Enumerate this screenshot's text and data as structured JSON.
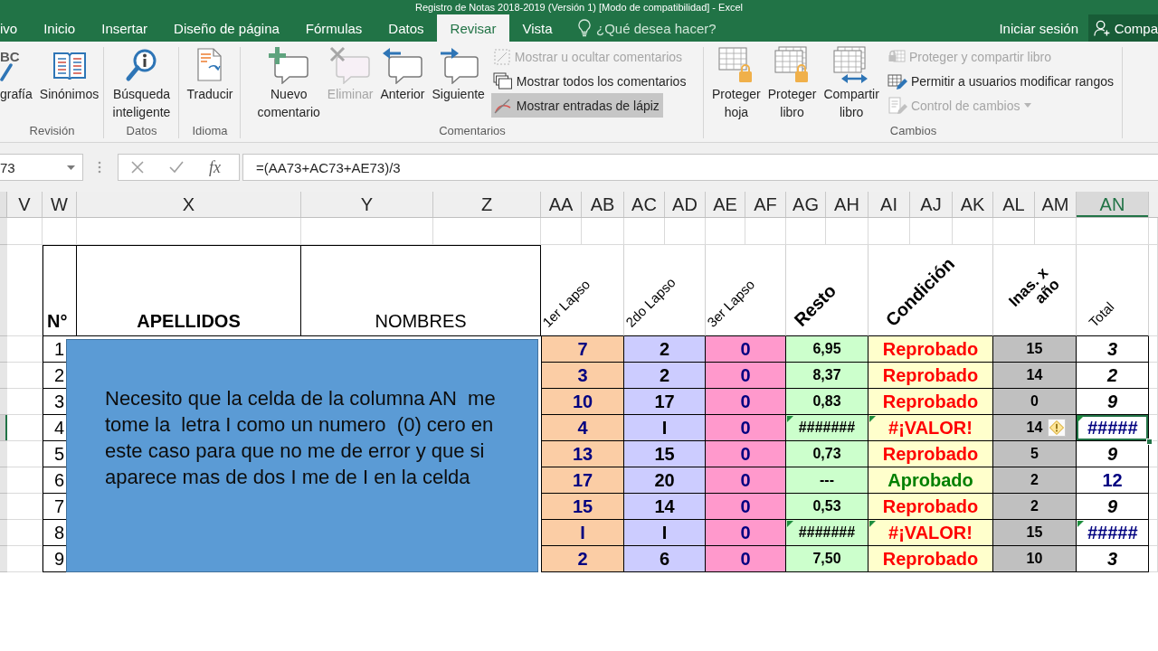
{
  "window": {
    "title": "Registro de Notas 2018-2019 (Versión 1) [Modo de compatibilidad] - Excel"
  },
  "ribbon_tabs": [
    {
      "label": "ivo",
      "selected": false
    },
    {
      "label": "Inicio",
      "selected": false
    },
    {
      "label": "Insertar",
      "selected": false
    },
    {
      "label": "Diseño de página",
      "selected": false
    },
    {
      "label": "Fórmulas",
      "selected": false
    },
    {
      "label": "Datos",
      "selected": false
    },
    {
      "label": "Revisar",
      "selected": true
    },
    {
      "label": "Vista",
      "selected": false
    }
  ],
  "tell_me": {
    "placeholder": "¿Qué desea hacer?"
  },
  "account": {
    "sign_in": "Iniciar sesión",
    "share": "Compa"
  },
  "ribbon_groups": [
    {
      "label": "Revisión",
      "buttons": [
        {
          "label": "grafía",
          "icon_text": "BC",
          "disabled": false
        },
        {
          "label": "Sinónimos",
          "disabled": false
        }
      ]
    },
    {
      "label": "Datos",
      "buttons": [
        {
          "label": "Búsqueda inteligente",
          "disabled": false
        }
      ]
    },
    {
      "label": "Idioma",
      "buttons": [
        {
          "label": "Traducir",
          "disabled": false
        }
      ]
    },
    {
      "label": "Comentarios",
      "buttons": [
        {
          "label": "Nuevo comentario",
          "disabled": false
        },
        {
          "label": "Eliminar",
          "disabled": true
        },
        {
          "label": "Anterior",
          "disabled": false
        },
        {
          "label": "Siguiente",
          "disabled": false
        }
      ],
      "small_buttons": [
        {
          "label": "Mostrar u ocultar comentarios",
          "disabled": true,
          "pressed": false,
          "dropdown": false
        },
        {
          "label": "Mostrar todos los comentarios",
          "disabled": false,
          "pressed": false,
          "dropdown": false
        },
        {
          "label": "Mostrar entradas de lápiz",
          "disabled": false,
          "pressed": true,
          "dropdown": false
        }
      ]
    },
    {
      "label": "Cambios",
      "buttons": [
        {
          "label": "Proteger hoja",
          "disabled": false
        },
        {
          "label": "Proteger libro",
          "disabled": false
        },
        {
          "label": "Compartir libro",
          "disabled": false
        }
      ],
      "small_buttons": [
        {
          "label": "Proteger y compartir libro",
          "disabled": true,
          "pressed": false,
          "dropdown": false
        },
        {
          "label": "Permitir a usuarios modificar rangos",
          "disabled": false,
          "pressed": false,
          "dropdown": false
        },
        {
          "label": "Control de cambios",
          "disabled": true,
          "pressed": false,
          "dropdown": true
        }
      ]
    }
  ],
  "formula_bar": {
    "name_box": "73",
    "function_label": "fx",
    "formula": "=(AA73+AC73+AE73)/3"
  },
  "columns": [
    {
      "label": "V",
      "selected": false
    },
    {
      "label": "W",
      "selected": false
    },
    {
      "label": "X",
      "selected": false
    },
    {
      "label": "Y",
      "selected": false
    },
    {
      "label": "Z",
      "selected": false
    },
    {
      "label": "AA",
      "selected": false
    },
    {
      "label": "AB",
      "selected": false
    },
    {
      "label": "AC",
      "selected": false
    },
    {
      "label": "AD",
      "selected": false
    },
    {
      "label": "AE",
      "selected": false
    },
    {
      "label": "AF",
      "selected": false
    },
    {
      "label": "AG",
      "selected": false
    },
    {
      "label": "AH",
      "selected": false
    },
    {
      "label": "AI",
      "selected": false
    },
    {
      "label": "AJ",
      "selected": false
    },
    {
      "label": "AK",
      "selected": false
    },
    {
      "label": "AL",
      "selected": false
    },
    {
      "label": "AM",
      "selected": false
    },
    {
      "label": "AN",
      "selected": true
    }
  ],
  "table": {
    "headers": {
      "number": "N°",
      "surnames": "APELLIDOS",
      "names": "NOMBRES",
      "lapso_1": "1er Lapso",
      "lapso_2": "2do Lapso",
      "lapso_3": "3er Lapso",
      "resto": "Resto",
      "condicion": "Condición",
      "inasistencias": "Inas. x año",
      "total": "Total"
    },
    "rows": [
      {
        "number": "1",
        "lapso_1": "7",
        "lapso_2": "2",
        "lapso_3": "0",
        "resto": {
          "text": "6,95",
          "error_indicator": false
        },
        "condicion": {
          "text": "Reprobado",
          "color": "#ff0000",
          "error_indicator": false
        },
        "inasistencias": "15",
        "total": {
          "text": "3",
          "color": "#000000",
          "italic": true,
          "error_indicator": false
        },
        "selected": false
      },
      {
        "number": "2",
        "lapso_1": "3",
        "lapso_2": "2",
        "lapso_3": "0",
        "resto": {
          "text": "8,37",
          "error_indicator": false
        },
        "condicion": {
          "text": "Reprobado",
          "color": "#ff0000",
          "error_indicator": false
        },
        "inasistencias": "14",
        "total": {
          "text": "2",
          "color": "#000000",
          "italic": true,
          "error_indicator": false
        },
        "selected": false
      },
      {
        "number": "3",
        "lapso_1": "10",
        "lapso_2": "17",
        "lapso_3": "0",
        "resto": {
          "text": "0,83",
          "error_indicator": false
        },
        "condicion": {
          "text": "Reprobado",
          "color": "#ff0000",
          "error_indicator": false
        },
        "inasistencias": "0",
        "total": {
          "text": "9",
          "color": "#000000",
          "italic": true,
          "error_indicator": false
        },
        "selected": false
      },
      {
        "number": "4",
        "lapso_1": "4",
        "lapso_2": "I",
        "lapso_3": "0",
        "resto": {
          "text": "#######",
          "error_indicator": true
        },
        "condicion": {
          "text": "#¡VALOR!",
          "color": "#ff0000",
          "error_indicator": true
        },
        "inasistencias": "14",
        "total": {
          "text": "#####",
          "color": "#000080",
          "italic": true,
          "error_indicator": true
        },
        "selected": true
      },
      {
        "number": "5",
        "lapso_1": "13",
        "lapso_2": "15",
        "lapso_3": "0",
        "resto": {
          "text": "0,73",
          "error_indicator": false
        },
        "condicion": {
          "text": "Reprobado",
          "color": "#ff0000",
          "error_indicator": false
        },
        "inasistencias": "5",
        "total": {
          "text": "9",
          "color": "#000000",
          "italic": true,
          "error_indicator": false
        },
        "selected": false
      },
      {
        "number": "6",
        "lapso_1": "17",
        "lapso_2": "20",
        "lapso_3": "0",
        "resto": {
          "text": "---",
          "error_indicator": false
        },
        "condicion": {
          "text": "Aprobado",
          "color": "#008000",
          "error_indicator": false
        },
        "inasistencias": "2",
        "total": {
          "text": "12",
          "color": "#000080",
          "italic": false,
          "error_indicator": false
        },
        "selected": false
      },
      {
        "number": "7",
        "lapso_1": "15",
        "lapso_2": "14",
        "lapso_3": "0",
        "resto": {
          "text": "0,53",
          "error_indicator": false
        },
        "condicion": {
          "text": "Reprobado",
          "color": "#ff0000",
          "error_indicator": false
        },
        "inasistencias": "2",
        "total": {
          "text": "9",
          "color": "#000000",
          "italic": true,
          "error_indicator": false
        },
        "selected": false
      },
      {
        "number": "8",
        "lapso_1": "I",
        "lapso_2": "I",
        "lapso_3": "0",
        "resto": {
          "text": "#######",
          "error_indicator": true
        },
        "condicion": {
          "text": "#¡VALOR!",
          "color": "#ff0000",
          "error_indicator": true
        },
        "inasistencias": "15",
        "total": {
          "text": "#####",
          "color": "#000080",
          "italic": true,
          "error_indicator": true
        },
        "selected": false
      },
      {
        "number": "9",
        "lapso_1": "2",
        "lapso_2": "6",
        "lapso_3": "0",
        "resto": {
          "text": "7,50",
          "error_indicator": false
        },
        "condicion": {
          "text": "Reprobado",
          "color": "#ff0000",
          "error_indicator": false
        },
        "inasistencias": "10",
        "total": {
          "text": "3",
          "color": "#000000",
          "italic": true,
          "error_indicator": false
        },
        "selected": false
      }
    ]
  },
  "note": {
    "text": "Necesito que la celda de la columna AN  me\ntome la  letra I como un numero  (0) cero en\neste caso para que no me de error y que si\naparece mas de dos I me de I en la celda"
  }
}
